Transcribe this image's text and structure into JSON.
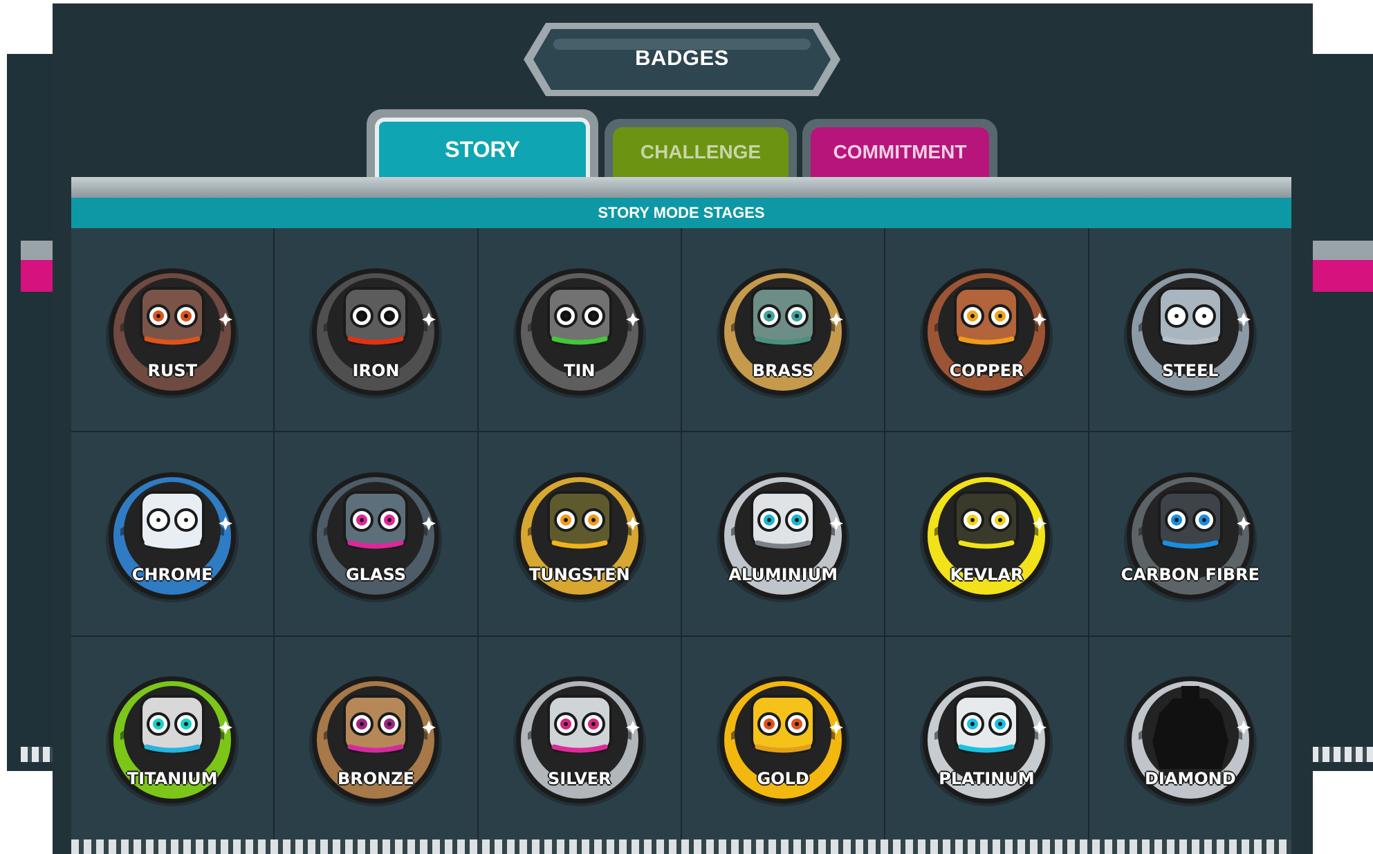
{
  "title": "BADGES",
  "tabs": [
    {
      "label": "STORY",
      "color": "#10a5b2",
      "active": true
    },
    {
      "label": "CHALLENGE",
      "color": "#6c9412",
      "active": false
    },
    {
      "label": "COMMITMENT",
      "color": "#b8157b",
      "active": false
    }
  ],
  "section_header": "STORY MODE STAGES",
  "badges": [
    {
      "label": "RUST",
      "rim": "#6e4a40",
      "head": "#7a5449",
      "eye": "#e0531e",
      "mouth": "#e0531e",
      "locked": false
    },
    {
      "label": "IRON",
      "rim": "#4f4f4f",
      "head": "#5c5c5c",
      "eye": "#111111",
      "mouth": "#e23214",
      "locked": false
    },
    {
      "label": "TIN",
      "rim": "#5e5e5e",
      "head": "#727272",
      "eye": "#111111",
      "mouth": "#43c83a",
      "locked": false
    },
    {
      "label": "BRASS",
      "rim": "#c59a4c",
      "head": "#6d8e86",
      "eye": "#3fa6a0",
      "mouth": "#4a8f7f",
      "locked": false
    },
    {
      "label": "COPPER",
      "rim": "#9c5534",
      "head": "#b3643a",
      "eye": "#f2a31a",
      "mouth": "#f29a1a",
      "locked": false
    },
    {
      "label": "STEEL",
      "rim": "#8c9aa6",
      "head": "#a9b5bf",
      "eye": "#ffffff",
      "mouth": "#b6c0c8",
      "locked": false
    },
    {
      "label": "CHROME",
      "rim": "#2f7cc4",
      "head": "#e8eef3",
      "eye": "#ffffff",
      "mouth": "#e8eef3",
      "locked": false
    },
    {
      "label": "GLASS",
      "rim": "#4d5c66",
      "head": "#5d6f7a",
      "eye": "#e0269a",
      "mouth": "#e0269a",
      "locked": false
    },
    {
      "label": "TUNGSTEN",
      "rim": "#d7a732",
      "head": "#5e5a2e",
      "eye": "#f29a1a",
      "mouth": "#f2b21a",
      "locked": false
    },
    {
      "label": "ALUMINIUM",
      "rim": "#bfc5ca",
      "head": "#dfe3e6",
      "eye": "#19b8d2",
      "mouth": "#7a8188",
      "locked": false
    },
    {
      "label": "KEVLAR",
      "rim": "#f2e21a",
      "head": "#3a3a2a",
      "eye": "#f2d21a",
      "mouth": "#f2e21a",
      "locked": false
    },
    {
      "label": "CARBON FIBRE",
      "rim": "#5d6468",
      "head": "#3d4348",
      "eye": "#1a8ee0",
      "mouth": "#1a8ee0",
      "locked": false
    },
    {
      "label": "TITANIUM",
      "rim": "#7cc61a",
      "head": "#d8d8d8",
      "eye": "#19d2c8",
      "mouth": "#26b4e0",
      "locked": false
    },
    {
      "label": "BRONZE",
      "rim": "#a77848",
      "head": "#b68858",
      "eye": "#a0267f",
      "mouth": "#d42aa0",
      "locked": false
    },
    {
      "label": "SILVER",
      "rim": "#b0b6ba",
      "head": "#cfd4d7",
      "eye": "#d4267f",
      "mouth": "#e02a9a",
      "locked": false
    },
    {
      "label": "GOLD",
      "rim": "#f2b80f",
      "head": "#f5c21a",
      "eye": "#e2531e",
      "mouth": "#e2a01a",
      "locked": false
    },
    {
      "label": "PLATINUM",
      "rim": "#c6ccd0",
      "head": "#e6eaed",
      "eye": "#1ac2e2",
      "mouth": "#1ac2e2",
      "locked": false
    },
    {
      "label": "DIAMOND",
      "rim": "#bfc5ca",
      "head": "#111111",
      "eye": "#111111",
      "mouth": "#111111",
      "locked": true
    }
  ]
}
